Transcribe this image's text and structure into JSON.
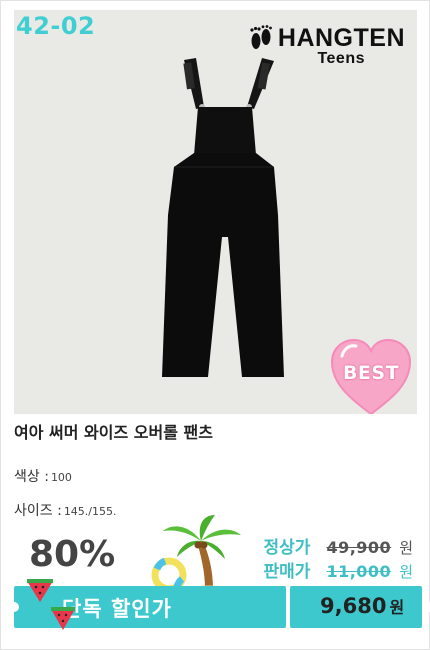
{
  "product": {
    "code": "42-02",
    "brand_name": "HANGTEN",
    "brand_sub": "Teens",
    "badge": "BEST",
    "title": "여아 써머 와이즈 오버롤 팬츠",
    "color_label": "색상 :",
    "color_value": "100",
    "size_label": "사이즈 :",
    "size_value": "145./155."
  },
  "pricing": {
    "discount_rate": "80%",
    "regular_label": "정상가",
    "regular_price": "49,900",
    "sale_label": "판매가",
    "sale_price": "11,000",
    "currency": "원",
    "banner_label": "단독 할인가",
    "final_price": "9,680",
    "final_currency": "원"
  },
  "colors": {
    "accent_teal": "#3cc8cd",
    "photo_bg": "#e9e9e6",
    "badge_pink": "#f7a6c8"
  },
  "icons": {
    "brand": "footprints-icon",
    "badge": "heart-badge-icon",
    "decor1": "palm-tree-icon",
    "decor2": "watermelon-icon"
  }
}
